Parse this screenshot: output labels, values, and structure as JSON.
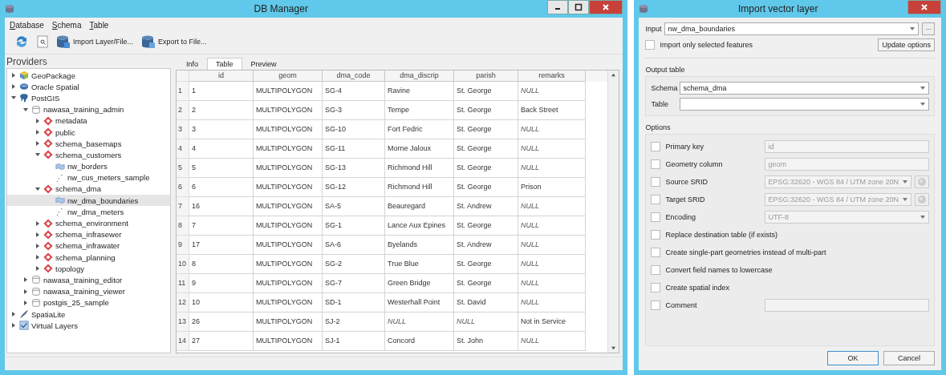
{
  "db_manager": {
    "title": "DB Manager",
    "menu": [
      "Database",
      "Schema",
      "Table"
    ],
    "toolbar": [
      {
        "kind": "refresh"
      },
      {
        "kind": "sql"
      },
      {
        "kind": "import",
        "label": "Import Layer/File..."
      },
      {
        "kind": "export",
        "label": "Export to File..."
      }
    ],
    "providers": {
      "title": "Providers",
      "tree": [
        {
          "kind": "geopackage",
          "label": "GeoPackage",
          "expanded": false
        },
        {
          "kind": "oracle",
          "label": "Oracle Spatial",
          "expanded": false
        },
        {
          "kind": "postgis",
          "label": "PostGIS",
          "expanded": true,
          "children": [
            {
              "kind": "database",
              "label": "nawasa_training_admin",
              "expanded": true,
              "children": [
                {
                  "kind": "schema",
                  "label": "metadata",
                  "expanded": false
                },
                {
                  "kind": "schema",
                  "label": "public",
                  "expanded": false
                },
                {
                  "kind": "schema",
                  "label": "schema_basemaps",
                  "expanded": false
                },
                {
                  "kind": "schema",
                  "label": "schema_customers",
                  "expanded": true,
                  "children": [
                    {
                      "kind": "polygon-layer",
                      "label": "nw_borders",
                      "selected": false
                    },
                    {
                      "kind": "point-layer",
                      "label": "nw_cus_meters_sample",
                      "selected": false
                    }
                  ]
                },
                {
                  "kind": "schema",
                  "label": "schema_dma",
                  "expanded": true,
                  "children": [
                    {
                      "kind": "polygon-layer",
                      "label": "nw_dma_boundaries",
                      "selected": true
                    },
                    {
                      "kind": "point-layer",
                      "label": "nw_dma_meters",
                      "selected": false
                    }
                  ]
                },
                {
                  "kind": "schema",
                  "label": "schema_environment",
                  "expanded": false
                },
                {
                  "kind": "schema",
                  "label": "schema_infrasewer",
                  "expanded": false
                },
                {
                  "kind": "schema",
                  "label": "schema_infrawater",
                  "expanded": false
                },
                {
                  "kind": "schema",
                  "label": "schema_planning",
                  "expanded": false
                },
                {
                  "kind": "schema",
                  "label": "topology",
                  "expanded": false
                }
              ]
            },
            {
              "kind": "database",
              "label": "nawasa_training_editor",
              "expanded": false
            },
            {
              "kind": "database",
              "label": "nawasa_training_viewer",
              "expanded": false
            },
            {
              "kind": "database",
              "label": "postgis_25_sample",
              "expanded": false
            }
          ]
        },
        {
          "kind": "spatialite",
          "label": "SpatiaLite",
          "expanded": false
        },
        {
          "kind": "virtual",
          "label": "Virtual Layers",
          "expanded": false
        }
      ]
    },
    "tabs": [
      {
        "label": "Info",
        "selected": false
      },
      {
        "label": "Table",
        "selected": true
      },
      {
        "label": "Preview",
        "selected": false
      }
    ],
    "table": {
      "columns": [
        "id",
        "geom",
        "dma_code",
        "dma_discrip",
        "parish",
        "remarks"
      ],
      "rows": [
        {
          "number": "1",
          "cells": [
            {
              "text": "1"
            },
            {
              "text": "MULTIPOLYGON"
            },
            {
              "text": "SG-4"
            },
            {
              "text": "Ravine"
            },
            {
              "text": "St. George"
            },
            {
              "text": "NULL",
              "null": true
            }
          ]
        },
        {
          "number": "2",
          "cells": [
            {
              "text": "2"
            },
            {
              "text": "MULTIPOLYGON"
            },
            {
              "text": "SG-3"
            },
            {
              "text": "Tempe"
            },
            {
              "text": "St. George"
            },
            {
              "text": "Back Street"
            }
          ]
        },
        {
          "number": "3",
          "cells": [
            {
              "text": "3"
            },
            {
              "text": "MULTIPOLYGON"
            },
            {
              "text": "SG-10"
            },
            {
              "text": "Fort Fedric"
            },
            {
              "text": "St. George"
            },
            {
              "text": "NULL",
              "null": true
            }
          ]
        },
        {
          "number": "4",
          "cells": [
            {
              "text": "4"
            },
            {
              "text": "MULTIPOLYGON"
            },
            {
              "text": "SG-11"
            },
            {
              "text": "Morne Jaloux"
            },
            {
              "text": "St. George"
            },
            {
              "text": "NULL",
              "null": true
            }
          ]
        },
        {
          "number": "5",
          "cells": [
            {
              "text": "5"
            },
            {
              "text": "MULTIPOLYGON"
            },
            {
              "text": "SG-13"
            },
            {
              "text": "Richmond Hill"
            },
            {
              "text": "St. George"
            },
            {
              "text": "NULL",
              "null": true
            }
          ]
        },
        {
          "number": "6",
          "cells": [
            {
              "text": "6"
            },
            {
              "text": "MULTIPOLYGON"
            },
            {
              "text": "SG-12"
            },
            {
              "text": "Richmond Hill"
            },
            {
              "text": "St. George"
            },
            {
              "text": "Prison"
            }
          ]
        },
        {
          "number": "7",
          "cells": [
            {
              "text": "16"
            },
            {
              "text": "MULTIPOLYGON"
            },
            {
              "text": "SA-5"
            },
            {
              "text": "Beauregard"
            },
            {
              "text": "St. Andrew"
            },
            {
              "text": "NULL",
              "null": true
            }
          ]
        },
        {
          "number": "8",
          "cells": [
            {
              "text": "7"
            },
            {
              "text": "MULTIPOLYGON"
            },
            {
              "text": "SG-1"
            },
            {
              "text": "Lance Aux Epines"
            },
            {
              "text": "St. George"
            },
            {
              "text": "NULL",
              "null": true
            }
          ]
        },
        {
          "number": "9",
          "cells": [
            {
              "text": "17"
            },
            {
              "text": "MULTIPOLYGON"
            },
            {
              "text": "SA-6"
            },
            {
              "text": "Byelands"
            },
            {
              "text": "St. Andrew"
            },
            {
              "text": "NULL",
              "null": true
            }
          ]
        },
        {
          "number": "10",
          "cells": [
            {
              "text": "8"
            },
            {
              "text": "MULTIPOLYGON"
            },
            {
              "text": "SG-2"
            },
            {
              "text": "True Blue"
            },
            {
              "text": "St. George"
            },
            {
              "text": "NULL",
              "null": true
            }
          ]
        },
        {
          "number": "11",
          "cells": [
            {
              "text": "9"
            },
            {
              "text": "MULTIPOLYGON"
            },
            {
              "text": "SG-7"
            },
            {
              "text": "Green Bridge"
            },
            {
              "text": "St. George"
            },
            {
              "text": "NULL",
              "null": true
            }
          ]
        },
        {
          "number": "12",
          "cells": [
            {
              "text": "10"
            },
            {
              "text": "MULTIPOLYGON"
            },
            {
              "text": "SD-1"
            },
            {
              "text": "Westerhall Point"
            },
            {
              "text": "St. David"
            },
            {
              "text": "NULL",
              "null": true
            }
          ]
        },
        {
          "number": "13",
          "cells": [
            {
              "text": "26"
            },
            {
              "text": "MULTIPOLYGON"
            },
            {
              "text": "SJ-2"
            },
            {
              "text": "NULL",
              "null": true
            },
            {
              "text": "NULL",
              "null": true
            },
            {
              "text": "Not in Service"
            }
          ]
        },
        {
          "number": "14",
          "cells": [
            {
              "text": "27"
            },
            {
              "text": "MULTIPOLYGON"
            },
            {
              "text": "SJ-1"
            },
            {
              "text": "Concord"
            },
            {
              "text": "St. John"
            },
            {
              "text": "NULL",
              "null": true
            }
          ]
        }
      ]
    }
  },
  "import_dialog": {
    "title": "Import vector layer",
    "input": {
      "label": "Input",
      "value": "nw_dma_boundaries",
      "browse": "..."
    },
    "only_selected": {
      "label": "Import only selected features",
      "checked": false
    },
    "update_button": "Update options",
    "output": {
      "title": "Output table",
      "schema": {
        "label": "Schema",
        "value": "schema_dma"
      },
      "table": {
        "label": "Table"
      }
    },
    "options": {
      "title": "Options",
      "items": [
        {
          "kind": "text",
          "label": "Primary key",
          "checked": false,
          "value": "id"
        },
        {
          "kind": "text",
          "label": "Geometry column",
          "checked": false,
          "value": "geom"
        },
        {
          "kind": "crs",
          "label": "Source SRID",
          "checked": false,
          "value": "EPSG:32620 - WGS 84 / UTM zone 20N"
        },
        {
          "kind": "crs",
          "label": "Target SRID",
          "checked": false,
          "value": "EPSG:32620 - WGS 84 / UTM zone 20N"
        },
        {
          "kind": "select",
          "label": "Encoding",
          "checked": false,
          "value": "UTF-8"
        },
        {
          "kind": "check",
          "label": "Replace destination table (if exists)",
          "checked": false
        },
        {
          "kind": "check",
          "label": "Create single-part geometries instead of multi-part",
          "checked": false
        },
        {
          "kind": "check",
          "label": "Convert field names to lowercase",
          "checked": false
        },
        {
          "kind": "check",
          "label": "Create spatial index",
          "checked": false
        },
        {
          "kind": "text",
          "label": "Comment",
          "checked": false
        }
      ]
    },
    "buttons": [
      "OK",
      "Cancel"
    ]
  }
}
